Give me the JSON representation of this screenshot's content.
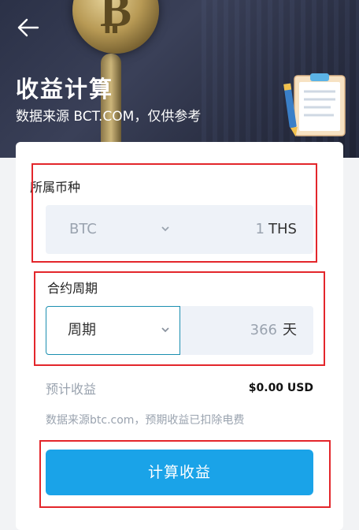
{
  "header": {
    "title": "收益计算",
    "subtitle": "数据来源 BCT.COM，仅供参考",
    "back_icon": "arrow-left-icon"
  },
  "coin_section": {
    "label": "所属币种",
    "coin_select": "BTC",
    "hashrate_value": "1",
    "hashrate_unit": "THS"
  },
  "period_section": {
    "label": "合约周期",
    "period_select": "周期",
    "days_value": "366",
    "days_unit": "天"
  },
  "result": {
    "label": "预计收益",
    "value": "$0.00 USD"
  },
  "note": "数据来源btc.com，预期收益已扣除电费",
  "calculate_button": "计算收益",
  "colors": {
    "primary": "#1aa3e8",
    "highlight": "#e3262b",
    "field_bg": "#eef2f8",
    "active_border": "#1b8fb0"
  }
}
